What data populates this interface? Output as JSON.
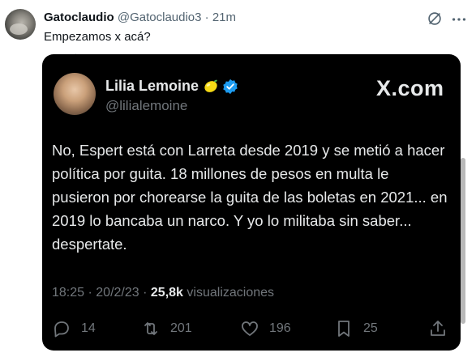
{
  "tweet": {
    "author_name": "Gatoclaudio",
    "author_handle": "@Gatoclaudio3",
    "separator": "·",
    "time": "21m",
    "text": "Empezamos x acá?"
  },
  "embedded": {
    "name": "Lilia Lemoine",
    "handle": "@lilialemoine",
    "watermark": "X.com",
    "body": "No, Espert está con Larreta desde 2019 y se metió a hacer política por guita. 18 millones de pesos en multa le pusieron por chorearse la guita de las boletas en 2021... en 2019 lo bancaba un narco. Y yo lo militaba sin saber... despertate.",
    "time": "18:25",
    "date": "20/2/23",
    "views_count": "25,8k",
    "views_label": "visualizaciones",
    "replies": "14",
    "retweets": "201",
    "likes": "196",
    "bookmarks": "25"
  },
  "colors": {
    "card_bg": "#000000",
    "verified": "#1d9bf0",
    "muted": "#71767b"
  }
}
